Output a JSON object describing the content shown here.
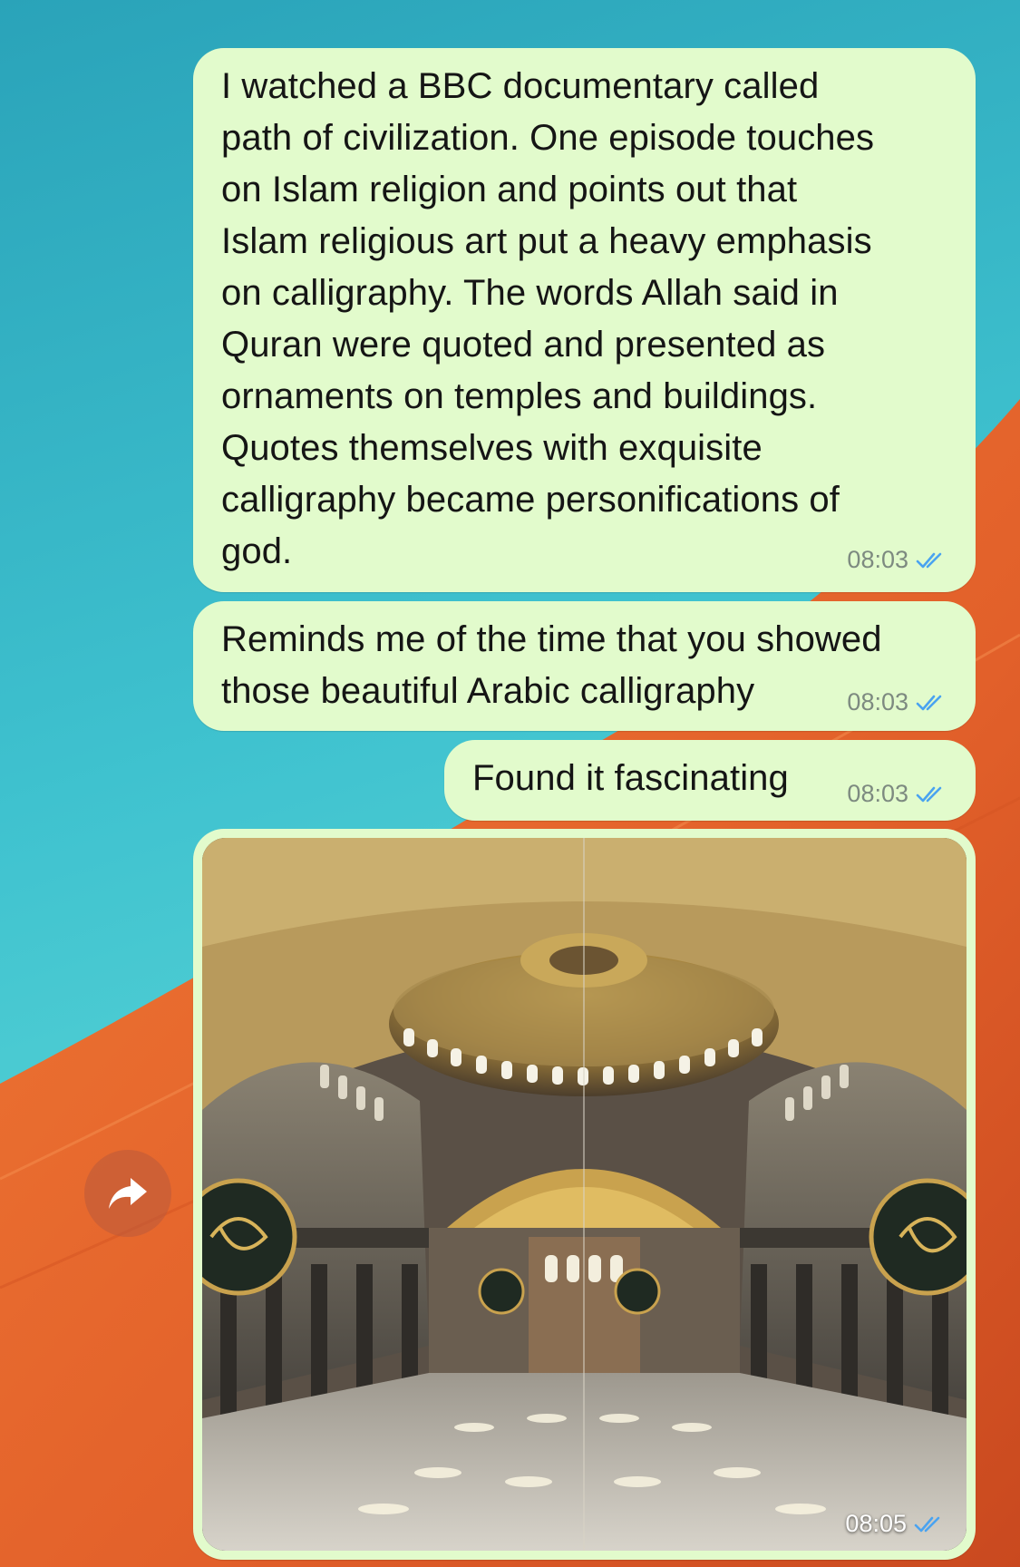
{
  "messages": [
    {
      "text": "I watched a BBC documentary called\npath of civilization. One episode touches\non Islam religion and points out that\nIslam religious art put a heavy emphasis\non calligraphy. The words Allah said in\nQuran were quoted and presented as\nornaments on temples and buildings.\nQuotes themselves with exquisite\ncalligraphy became personifications of\ngod.",
      "time": "08:03",
      "status_icon": "double-check-icon"
    },
    {
      "text": "Reminds me of the time that you showed\nthose beautiful Arabic calligraphy",
      "time": "08:03",
      "status_icon": "double-check-icon"
    },
    {
      "text": "Found it fascinating",
      "time": "08:03",
      "status_icon": "double-check-icon"
    }
  ],
  "image_message": {
    "image": "hagia-sophia-interior-photo",
    "time": "08:05",
    "status_icon": "double-check-icon"
  },
  "forward_button": {
    "icon": "forward-arrow-icon"
  },
  "colors": {
    "outgoing_bubble": "#e2fbcc",
    "read_ticks": "#4aa3f0",
    "sky_wallpaper": "#3cbfcb",
    "dune_wallpaper": "#e8692c"
  }
}
